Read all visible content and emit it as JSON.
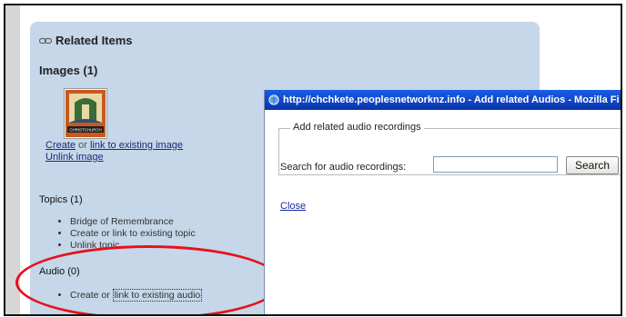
{
  "related": {
    "title": "Related Items",
    "images_heading": "Images (1)",
    "image_thumb_text": "CHRISTCHURCH",
    "create_label": "Create",
    "or_text": " or ",
    "link_existing_image": "link to existing image",
    "unlink_image": "Unlink image",
    "topics_heading": "Topics (1)",
    "topics": [
      "Bridge of Remembrance",
      "Create or link to existing topic",
      "Unlink topic"
    ],
    "audio_heading": "Audio (0)",
    "audio_create_prefix": "Create or ",
    "audio_link": "link to existing audio"
  },
  "popup": {
    "title": "http://chchkete.peoplesnetworknz.info - Add related Audios - Mozilla Fi",
    "fieldset_legend": "Add related audio recordings",
    "search_label": "Search for audio recordings:",
    "search_value": "",
    "search_button": "Search",
    "close_link": "Close"
  },
  "colors": {
    "panel_bg": "#c5d7e8",
    "highlight_ellipse": "#e8101a",
    "titlebar": "#0a3fb4",
    "link": "#1a2b7a"
  }
}
